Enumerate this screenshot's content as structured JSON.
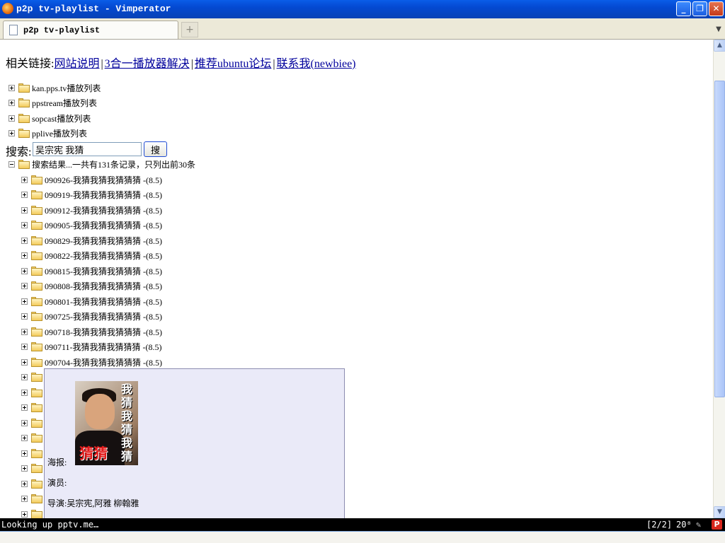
{
  "window": {
    "title": "p2p tv-playlist - Vimperator"
  },
  "tabs": [
    {
      "label": "p2p tv-playlist"
    }
  ],
  "new_tab_symbol": "+",
  "links": {
    "prefix": "相关链接:",
    "items": [
      "网站说明",
      "3合一播放器解决",
      "推荐ubuntu论坛",
      "联系我(newbiee)"
    ],
    "separator": "|"
  },
  "categories": [
    "kan.pps.tv播放列表",
    "ppstream播放列表",
    "sopcast播放列表",
    "pplive播放列表"
  ],
  "search": {
    "label": "搜索:",
    "value": "吴宗宪 我猜",
    "button": "搜"
  },
  "results": {
    "header": "搜索结果...一共有131条记录，只列出前30条",
    "items": [
      "090926-我猜我猜我猜猜猜 -(8.5)",
      "090919-我猜我猜我猜猜猜 -(8.5)",
      "090912-我猜我猜我猜猜猜 -(8.5)",
      "090905-我猜我猜我猜猜猜 -(8.5)",
      "090829-我猜我猜我猜猜猜 -(8.5)",
      "090822-我猜我猜我猜猜猜 -(8.5)",
      "090815-我猜我猜我猜猜猜 -(8.5)",
      "090808-我猜我猜我猜猜猜 -(8.5)",
      "090801-我猜我猜我猜猜猜 -(8.5)",
      "090725-我猜我猜我猜猜猜 -(8.5)",
      "090718-我猜我猜我猜猜猜 -(8.5)",
      "090711-我猜我猜我猜猜猜 -(8.5)",
      "090704-我猜我猜我猜猜猜 -(8.5)"
    ]
  },
  "popup": {
    "poster_title": "我猜我猜我猜",
    "poster_title_red": "猜猜",
    "poster_label": "海报:",
    "actors_label": "演员:",
    "director_label": "导演:",
    "director_value": "吴宗宪,阿雅 柳翰雅"
  },
  "statusbar": {
    "text": "Looking up pptv.me…",
    "position": "[2/2]",
    "zoom": "20⁸",
    "addon": "P"
  },
  "colors": {
    "link": "#00009c",
    "titlebar": "#0449d1",
    "popup_bg": "#eaeaf8"
  }
}
